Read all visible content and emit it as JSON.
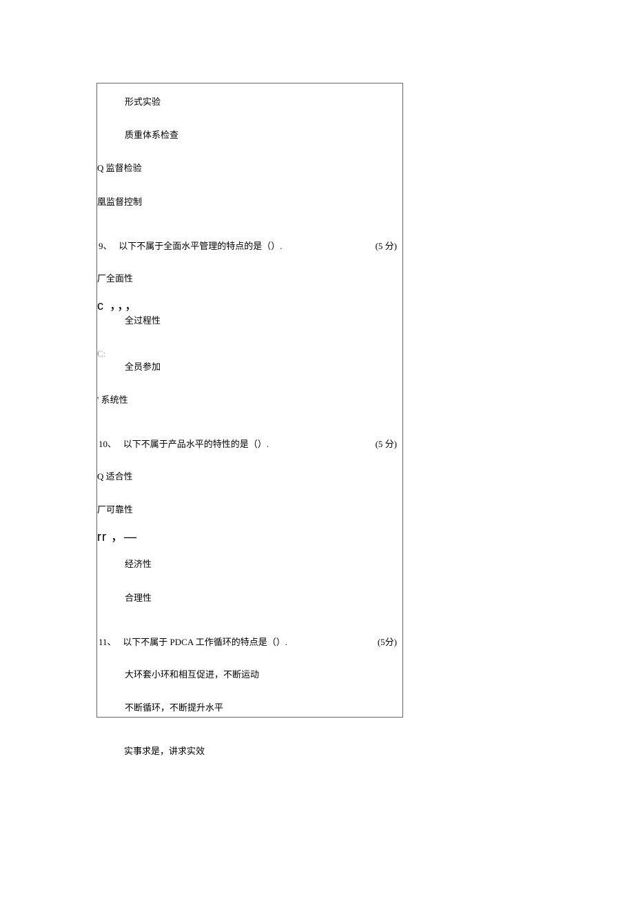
{
  "box": {
    "opt_a": "形式实验",
    "opt_b": "质重体系检查",
    "opt_c": "Q 监督检验",
    "opt_d": "凰监督控制",
    "q9": {
      "num": "9、",
      "text": "以下不属于全面水平管理的特点的是（）.",
      "score": "(5 分)"
    },
    "q9a": "厂全面性",
    "q9mark1": "c ，，，",
    "q9b": "全过程性",
    "q9mark2": "C:",
    "q9c": "全员参加",
    "q9d": "' 系统性",
    "q10": {
      "num": "10、",
      "text": "以下不属于产品水平的特性的是（）.",
      "score": "(5 分)"
    },
    "q10a": "Q 适合性",
    "q10b": "厂可靠性",
    "q10mark": "rr ，—",
    "q10c": "经济性",
    "q10d": "合理性",
    "q11": {
      "num": "11、",
      "text": "以下不属于 PDCA 工作循环的特点是（）.",
      "score": "(5分)"
    },
    "q11a": "大环套小环和相互促进，不断运动",
    "q11b": "不断循环，不断提升水平"
  },
  "below": {
    "line": "实事求是，讲求实效"
  }
}
